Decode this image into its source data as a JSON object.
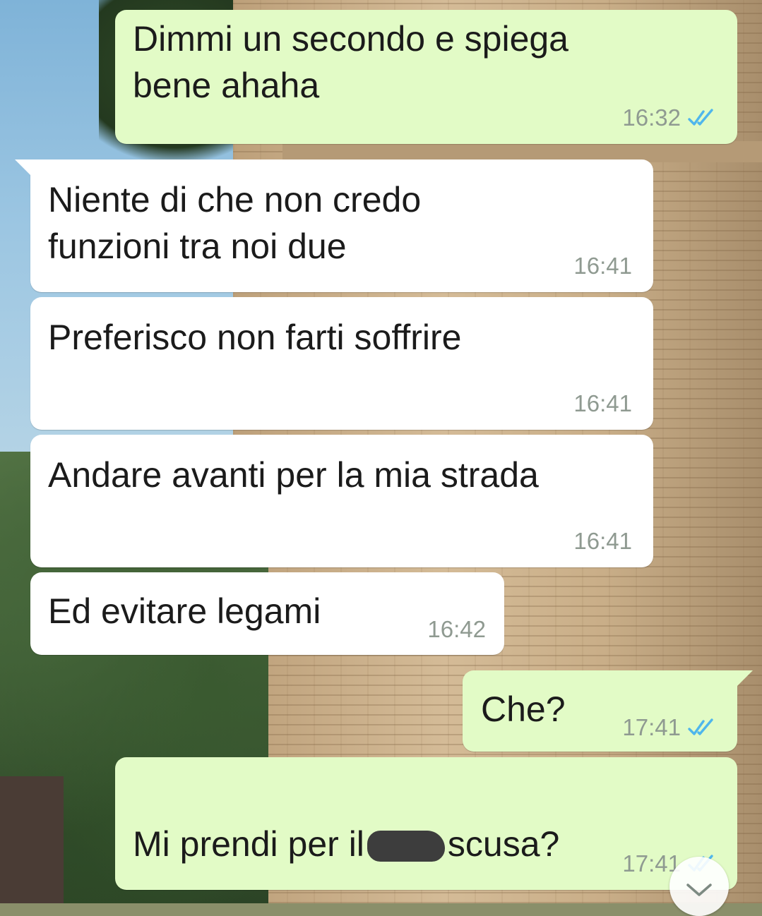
{
  "conversation": {
    "messages": [
      {
        "direction": "outgoing",
        "text": "Dimmi un secondo e spiega\nbene ahaha",
        "time": "16:32",
        "status": "read"
      },
      {
        "direction": "incoming",
        "text": "Niente di che non credo\nfunzioni tra noi due",
        "time": "16:41"
      },
      {
        "direction": "incoming",
        "text": "Preferisco non farti soffrire",
        "time": "16:41"
      },
      {
        "direction": "incoming",
        "text": "Andare avanti per la mia strada",
        "time": "16:41"
      },
      {
        "direction": "incoming",
        "text": "Ed evitare legami",
        "time": "16:42"
      },
      {
        "direction": "outgoing",
        "text": "Che?",
        "time": "17:41",
        "status": "read"
      },
      {
        "direction": "outgoing",
        "text_before": "Mi prendi per il",
        "text_after": "scusa?",
        "time": "17:41",
        "status": "read",
        "redacted": true
      }
    ]
  },
  "colors": {
    "incoming_bubble": "#ffffff",
    "outgoing_bubble": "#e2fbc6",
    "read_ticks": "#4fb6ec",
    "timestamp": "#8f9a91"
  },
  "icons": {
    "read_status": "double-check-icon",
    "scroll_down": "chevron-down-icon"
  }
}
